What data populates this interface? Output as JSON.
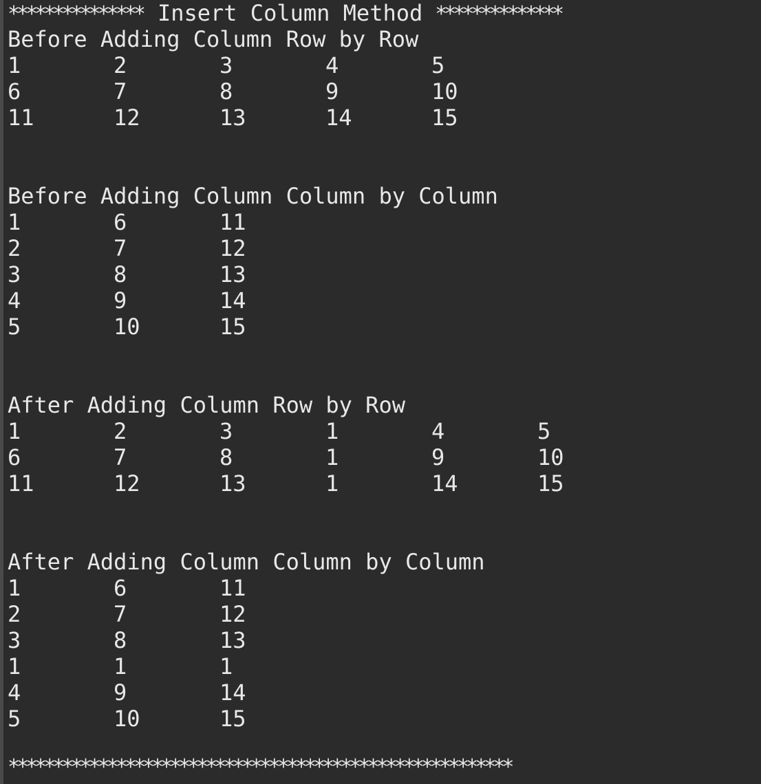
{
  "title": {
    "stars_left": "***************",
    "text": "Insert Column Method",
    "stars_right": "**************"
  },
  "sections": [
    {
      "heading": "Before Adding Column Row by Row",
      "rows": [
        [
          "1",
          "2",
          "3",
          "4",
          "5"
        ],
        [
          "6",
          "7",
          "8",
          "9",
          "10"
        ],
        [
          "11",
          "12",
          "13",
          "14",
          "15"
        ]
      ]
    },
    {
      "heading": "Before Adding Column Column by Column",
      "rows": [
        [
          "1",
          "6",
          "11"
        ],
        [
          "2",
          "7",
          "12"
        ],
        [
          "3",
          "8",
          "13"
        ],
        [
          "4",
          "9",
          "14"
        ],
        [
          "5",
          "10",
          "15"
        ]
      ]
    },
    {
      "heading": "After Adding Column Row by Row",
      "rows": [
        [
          "1",
          "2",
          "3",
          "1",
          "4",
          "5"
        ],
        [
          "6",
          "7",
          "8",
          "1",
          "9",
          "10"
        ],
        [
          "11",
          "12",
          "13",
          "1",
          "14",
          "15"
        ]
      ]
    },
    {
      "heading": "After Adding Column Column by Column",
      "rows": [
        [
          "1",
          "6",
          "11"
        ],
        [
          "2",
          "7",
          "12"
        ],
        [
          "3",
          "8",
          "13"
        ],
        [
          "1",
          "1",
          "1"
        ],
        [
          "4",
          "9",
          "14"
        ],
        [
          "5",
          "10",
          "15"
        ]
      ]
    }
  ],
  "footer": "********************************************************",
  "colors": {
    "background": "#2b2b2b",
    "text": "#e8e8e8"
  }
}
